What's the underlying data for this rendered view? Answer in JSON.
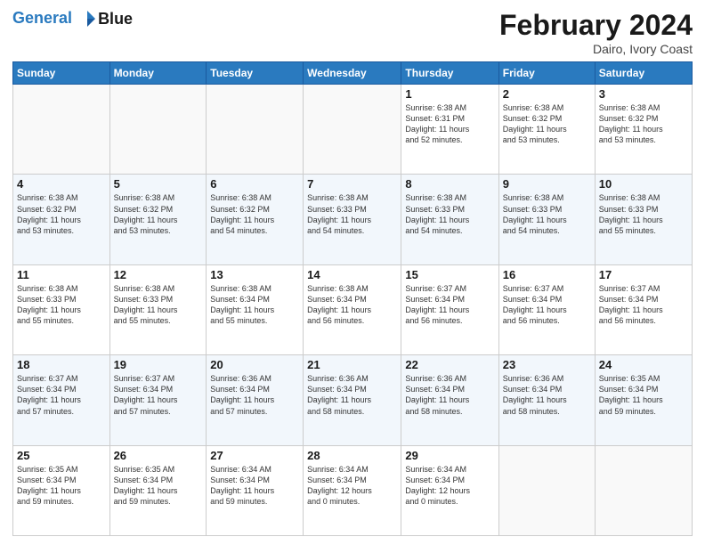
{
  "header": {
    "logo_line1": "General",
    "logo_line2": "Blue",
    "month_title": "February 2024",
    "location": "Dairo, Ivory Coast"
  },
  "days_of_week": [
    "Sunday",
    "Monday",
    "Tuesday",
    "Wednesday",
    "Thursday",
    "Friday",
    "Saturday"
  ],
  "weeks": [
    [
      {
        "num": "",
        "info": ""
      },
      {
        "num": "",
        "info": ""
      },
      {
        "num": "",
        "info": ""
      },
      {
        "num": "",
        "info": ""
      },
      {
        "num": "1",
        "info": "Sunrise: 6:38 AM\nSunset: 6:31 PM\nDaylight: 11 hours\nand 52 minutes."
      },
      {
        "num": "2",
        "info": "Sunrise: 6:38 AM\nSunset: 6:32 PM\nDaylight: 11 hours\nand 53 minutes."
      },
      {
        "num": "3",
        "info": "Sunrise: 6:38 AM\nSunset: 6:32 PM\nDaylight: 11 hours\nand 53 minutes."
      }
    ],
    [
      {
        "num": "4",
        "info": "Sunrise: 6:38 AM\nSunset: 6:32 PM\nDaylight: 11 hours\nand 53 minutes."
      },
      {
        "num": "5",
        "info": "Sunrise: 6:38 AM\nSunset: 6:32 PM\nDaylight: 11 hours\nand 53 minutes."
      },
      {
        "num": "6",
        "info": "Sunrise: 6:38 AM\nSunset: 6:32 PM\nDaylight: 11 hours\nand 54 minutes."
      },
      {
        "num": "7",
        "info": "Sunrise: 6:38 AM\nSunset: 6:33 PM\nDaylight: 11 hours\nand 54 minutes."
      },
      {
        "num": "8",
        "info": "Sunrise: 6:38 AM\nSunset: 6:33 PM\nDaylight: 11 hours\nand 54 minutes."
      },
      {
        "num": "9",
        "info": "Sunrise: 6:38 AM\nSunset: 6:33 PM\nDaylight: 11 hours\nand 54 minutes."
      },
      {
        "num": "10",
        "info": "Sunrise: 6:38 AM\nSunset: 6:33 PM\nDaylight: 11 hours\nand 55 minutes."
      }
    ],
    [
      {
        "num": "11",
        "info": "Sunrise: 6:38 AM\nSunset: 6:33 PM\nDaylight: 11 hours\nand 55 minutes."
      },
      {
        "num": "12",
        "info": "Sunrise: 6:38 AM\nSunset: 6:33 PM\nDaylight: 11 hours\nand 55 minutes."
      },
      {
        "num": "13",
        "info": "Sunrise: 6:38 AM\nSunset: 6:34 PM\nDaylight: 11 hours\nand 55 minutes."
      },
      {
        "num": "14",
        "info": "Sunrise: 6:38 AM\nSunset: 6:34 PM\nDaylight: 11 hours\nand 56 minutes."
      },
      {
        "num": "15",
        "info": "Sunrise: 6:37 AM\nSunset: 6:34 PM\nDaylight: 11 hours\nand 56 minutes."
      },
      {
        "num": "16",
        "info": "Sunrise: 6:37 AM\nSunset: 6:34 PM\nDaylight: 11 hours\nand 56 minutes."
      },
      {
        "num": "17",
        "info": "Sunrise: 6:37 AM\nSunset: 6:34 PM\nDaylight: 11 hours\nand 56 minutes."
      }
    ],
    [
      {
        "num": "18",
        "info": "Sunrise: 6:37 AM\nSunset: 6:34 PM\nDaylight: 11 hours\nand 57 minutes."
      },
      {
        "num": "19",
        "info": "Sunrise: 6:37 AM\nSunset: 6:34 PM\nDaylight: 11 hours\nand 57 minutes."
      },
      {
        "num": "20",
        "info": "Sunrise: 6:36 AM\nSunset: 6:34 PM\nDaylight: 11 hours\nand 57 minutes."
      },
      {
        "num": "21",
        "info": "Sunrise: 6:36 AM\nSunset: 6:34 PM\nDaylight: 11 hours\nand 58 minutes."
      },
      {
        "num": "22",
        "info": "Sunrise: 6:36 AM\nSunset: 6:34 PM\nDaylight: 11 hours\nand 58 minutes."
      },
      {
        "num": "23",
        "info": "Sunrise: 6:36 AM\nSunset: 6:34 PM\nDaylight: 11 hours\nand 58 minutes."
      },
      {
        "num": "24",
        "info": "Sunrise: 6:35 AM\nSunset: 6:34 PM\nDaylight: 11 hours\nand 59 minutes."
      }
    ],
    [
      {
        "num": "25",
        "info": "Sunrise: 6:35 AM\nSunset: 6:34 PM\nDaylight: 11 hours\nand 59 minutes."
      },
      {
        "num": "26",
        "info": "Sunrise: 6:35 AM\nSunset: 6:34 PM\nDaylight: 11 hours\nand 59 minutes."
      },
      {
        "num": "27",
        "info": "Sunrise: 6:34 AM\nSunset: 6:34 PM\nDaylight: 11 hours\nand 59 minutes."
      },
      {
        "num": "28",
        "info": "Sunrise: 6:34 AM\nSunset: 6:34 PM\nDaylight: 12 hours\nand 0 minutes."
      },
      {
        "num": "29",
        "info": "Sunrise: 6:34 AM\nSunset: 6:34 PM\nDaylight: 12 hours\nand 0 minutes."
      },
      {
        "num": "",
        "info": ""
      },
      {
        "num": "",
        "info": ""
      }
    ]
  ]
}
